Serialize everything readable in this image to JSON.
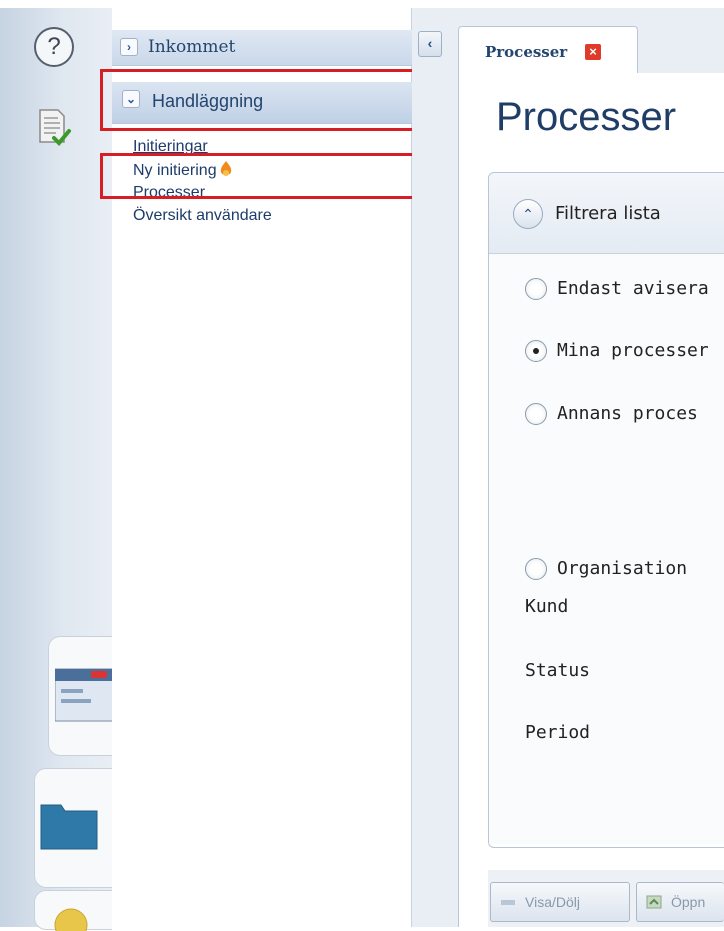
{
  "rail": {
    "help_symbol": "?",
    "icons": [
      "help-icon",
      "document-check-icon",
      "window-icon",
      "folder-icon",
      "circle-icon"
    ]
  },
  "nav": {
    "sections": [
      {
        "label": "Inkommet",
        "expanded": false
      },
      {
        "label": "Handläggning",
        "expanded": true
      }
    ],
    "links": [
      "Initieringar",
      "Ny initiering",
      "Processer",
      "Översikt användare"
    ]
  },
  "tab": {
    "label": "Processer"
  },
  "page": {
    "title": "Processer"
  },
  "filter": {
    "toggle_label": "Filtrera lista",
    "options": [
      {
        "label": "Endast avisera",
        "checked": false
      },
      {
        "label": "Mina processer",
        "checked": true
      },
      {
        "label": "Annans proces",
        "checked": false
      },
      {
        "label": "Organisation",
        "checked": false
      }
    ],
    "fields": [
      "Kund",
      "Status",
      "Period"
    ]
  },
  "buttons": {
    "toggle": "Visa/Dölj",
    "open": "Öppn"
  },
  "colors": {
    "highlight": "#d81e25",
    "nav_text": "#1d3c6b",
    "title": "#1f3d66"
  }
}
